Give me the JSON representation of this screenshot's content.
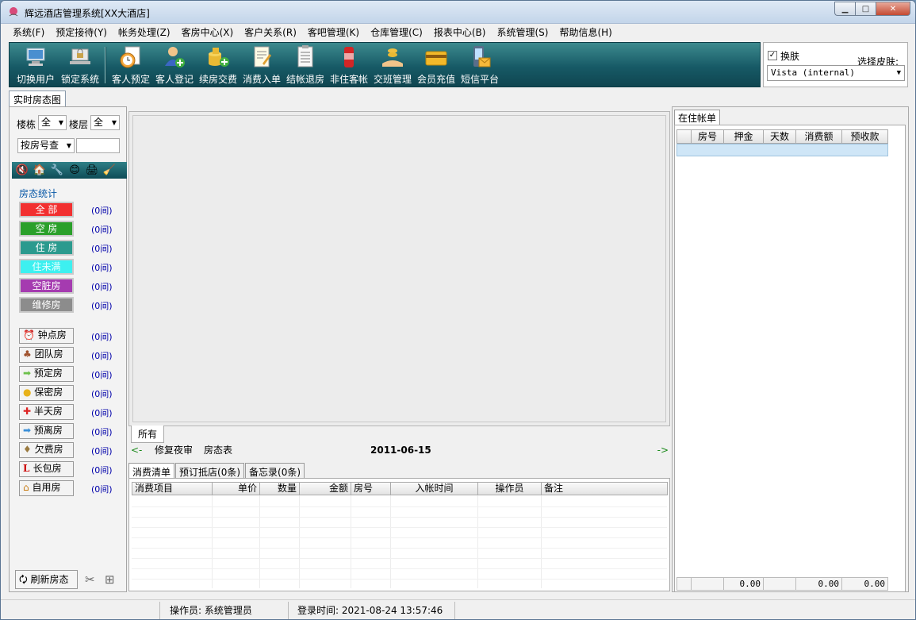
{
  "window": {
    "title": "辉远酒店管理系统[XX大酒店]"
  },
  "menu": [
    "系统(F)",
    "预定接待(Y)",
    "帐务处理(Z)",
    "客房中心(X)",
    "客户关系(R)",
    "客吧管理(K)",
    "仓库管理(C)",
    "报表中心(B)",
    "系统管理(S)",
    "帮助信息(H)"
  ],
  "toolbar": [
    {
      "label": "切换用户",
      "icon": "monitor-icon"
    },
    {
      "label": "锁定系统",
      "icon": "lock-laptop-icon"
    },
    {
      "label": "客人预定",
      "icon": "clock-icon"
    },
    {
      "label": "客人登记",
      "icon": "add-user-icon"
    },
    {
      "label": "续房交费",
      "icon": "coins-icon"
    },
    {
      "label": "消费入单",
      "icon": "edit-document-icon"
    },
    {
      "label": "结帐退房",
      "icon": "checklist-icon"
    },
    {
      "label": "非住客帐",
      "icon": "can-icon"
    },
    {
      "label": "交班管理",
      "icon": "handover-icon"
    },
    {
      "label": "会员充值",
      "icon": "card-icon"
    },
    {
      "label": "短信平台",
      "icon": "phone-mail-icon"
    }
  ],
  "skin": {
    "checkbox_label": "换肤",
    "checked": true,
    "select_label": "选择皮肤:",
    "select_value": "Vista (internal)"
  },
  "main_tab": "实时房态图",
  "filters": {
    "building_label": "楼栋",
    "building_value": "全",
    "floor_label": "楼层",
    "floor_value": "全",
    "search_mode": "按房号查",
    "search_value": ""
  },
  "stats": {
    "title": "房态统计",
    "status_items": [
      {
        "label": "全  部",
        "count": "(0间)",
        "color": "#f23030"
      },
      {
        "label": "空  房",
        "count": "(0间)",
        "color": "#2aa02a"
      },
      {
        "label": "住  房",
        "count": "(0间)",
        "color": "#2b9a8e"
      },
      {
        "label": "住未满",
        "count": "(0间)",
        "color": "#3df0f0"
      },
      {
        "label": "空脏房",
        "count": "(0间)",
        "color": "#a53bb0"
      },
      {
        "label": "维修房",
        "count": "(0间)",
        "color": "#8c8c8c"
      }
    ],
    "type_items": [
      {
        "label": "钟点房",
        "count": "(0间)",
        "icon": "clock-icon"
      },
      {
        "label": "团队房",
        "count": "(0间)",
        "icon": "group-icon"
      },
      {
        "label": "预定房",
        "count": "(0间)",
        "icon": "arrow-right-icon"
      },
      {
        "label": "保密房",
        "count": "(0间)",
        "icon": "bulb-icon"
      },
      {
        "label": "半天房",
        "count": "(0间)",
        "icon": "half-day-icon"
      },
      {
        "label": "预离房",
        "count": "(0间)",
        "icon": "depart-arrow-icon"
      },
      {
        "label": "欠费房",
        "count": "(0间)",
        "icon": "money-bag-icon"
      },
      {
        "label": "长包房",
        "count": "(0间)",
        "icon": "long-stay-icon"
      },
      {
        "label": "自用房",
        "count": "(0间)",
        "icon": "house-icon"
      }
    ],
    "refresh_label": "刷新房态"
  },
  "center": {
    "all_tab": "所有",
    "nav_prev": "<-",
    "nav_next": "->",
    "fix_audit": "修复夜审",
    "room_table": "房态表",
    "date": "2011-06-15"
  },
  "bottom_tabs": [
    "消费清单",
    "预订抵店(0条)",
    "备忘录(0条)"
  ],
  "consumption_columns": [
    "消费项目",
    "单价",
    "数量",
    "金额",
    "房号",
    "入帐时间",
    "操作员",
    "备注"
  ],
  "right": {
    "tab": "在住帐单",
    "columns": [
      "房号",
      "押金",
      "天数",
      "消费额",
      "预收款"
    ],
    "totals": [
      "0.00",
      "0.00",
      "0.00"
    ]
  },
  "status": {
    "operator": "操作员: 系统管理员",
    "login_time": "登录时间: 2021-08-24 13:57:46"
  }
}
